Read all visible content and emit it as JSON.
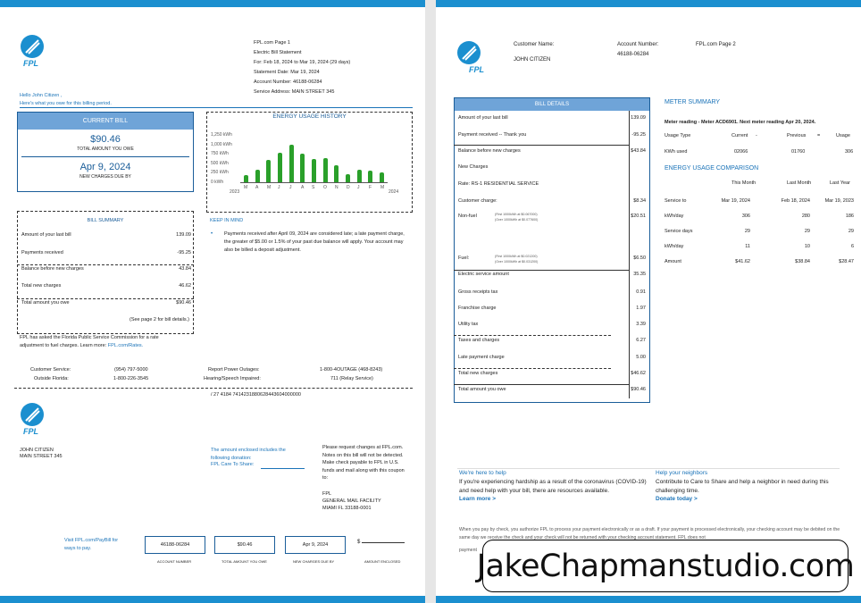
{
  "p1": {
    "header_lines": [
      "FPL.com   Page 1",
      "Electric Bill Statement",
      "For: Feb 18, 2024 to Mar 19, 2024 (29 days)",
      "Statement Date:  Mar 19, 2024",
      "Account Number: 46188-06284",
      "Service Address: MAIN STREET 345"
    ],
    "logo": "FPL",
    "greeting": "Hello John Citizen ,",
    "greeting2": "Here's what you owe for this billing period.",
    "current_bill": {
      "title": "CURRENT BILL",
      "amount": "$90.46",
      "amount_label": "TOTAL AMOUNT YOU OWE",
      "due_date": "Apr 9, 2024",
      "due_label": "NEW CHARGES DUE BY"
    },
    "energy": {
      "title": "ENERGY USAGE HISTORY",
      "yticks": [
        "1,250 kWh",
        "1,000 kWh",
        "750 kWh",
        "500 kWh",
        "250 kWh",
        "0 kWh"
      ],
      "months": [
        "M",
        "A",
        "M",
        "J",
        "J",
        "A",
        "S",
        "O",
        "N",
        "D",
        "J",
        "F",
        "M"
      ],
      "year_start": "2023",
      "year_end": "2024"
    },
    "chart_data": {
      "type": "bar",
      "title": "ENERGY USAGE HISTORY",
      "ylabel": "",
      "ylim": [
        0,
        1250
      ],
      "categories": [
        "M",
        "A",
        "M",
        "J",
        "J",
        "A",
        "S",
        "O",
        "N",
        "D",
        "J",
        "F",
        "M"
      ],
      "values": [
        190,
        320,
        600,
        770,
        1000,
        760,
        620,
        630,
        440,
        220,
        340,
        300,
        260
      ]
    },
    "bill_summary": {
      "title": "BILL SUMMARY",
      "rows": [
        [
          "Amount of your last bill",
          "139.09"
        ],
        [
          "Payments received",
          "-95.25"
        ],
        [
          "Balance before new charges",
          "43.84"
        ],
        [
          "Total new charges",
          "46.62"
        ],
        [
          "Total amount you owe",
          "$90.46"
        ]
      ],
      "note": "(See page 2 for bill details.)"
    },
    "keep_in_mind": {
      "title": "KEEP IN MIND",
      "bullet": "Payments received after April 09, 2024 are considered late; a late payment charge, the greater of $5.00 or 1.5% of your past due balance will apply. Your account may also be billed a deposit adjustment."
    },
    "psc_note": "FPL has asked the Florida Public Service Commission for a rate adjustment to fuel charges. Learn more:",
    "psc_link": "FPL.com/Rates.",
    "contacts": [
      [
        "Customer Service:",
        "(954) 797-5000",
        "Report Power Outages:",
        "1-800-4OUTAGE (468-8243)"
      ],
      [
        "Outside Florida:",
        "1-800-226-3545",
        "Hearing/Speech Impaired:",
        "711 (Relay Service)"
      ]
    ],
    "scanline": "/ 27 4184 7414231880628443604000000",
    "stub_name": "JOHN CITIZEN",
    "stub_addr": "MAIN STREET 345",
    "donation": "The amount enclosed includes the following donation:",
    "donation2": "FPL Care To Share:",
    "request_text": "Please request changes at FPL.com. Notes on this bill will not be detected. Make check payable to FPL in U.S. funds and mail along with this coupon to:",
    "mail_lines": [
      "FPL",
      "GENERAL MAIL FACILITY",
      "MIAMI FL 33188-0001"
    ],
    "visit": "Visit FPL.com/PayBill for ways to pay.",
    "stub_boxes": [
      {
        "value": "46188-06284",
        "label": "ACCOUNT NUMBER"
      },
      {
        "value": "$90.46",
        "label": "TOTAL AMOUNT YOU OWE"
      },
      {
        "value": "Apr 9, 2024",
        "label": "NEW CHARGES DUE BY"
      }
    ],
    "enclosed_label": "AMOUNT ENCLOSED",
    "enclosed_value": "$"
  },
  "p2": {
    "logo": "FPL",
    "cust_name_label": "Customer Name:",
    "cust_name": "JOHN CITIZEN",
    "acct_label": "Account Number:",
    "acct": "46188-06284",
    "page_label": "FPL.com Page 2",
    "bill_details": {
      "title": "BILL DETAILS",
      "rows": [
        [
          "Amount of your last bill",
          "139.09"
        ],
        [
          "Payment received -- Thank you",
          "-95.25"
        ],
        [
          "Balance before new charges",
          "$43.84"
        ],
        [
          "New Charges",
          ""
        ],
        [
          "Rate: RS-1 RESIDENTIAL SERVICE",
          ""
        ],
        [
          "Customer charge:",
          "$8.34"
        ],
        [
          "Non-fuel",
          "$20.51"
        ],
        [
          "Fuel:",
          "$6.50"
        ],
        [
          "Electric service amount",
          "35.35"
        ],
        [
          "Gross receipts tax",
          "0.91"
        ],
        [
          "Franchise charge",
          "1.97"
        ],
        [
          "Utility tax",
          "3.39"
        ],
        [
          "Taxes and charges",
          "6.27"
        ],
        [
          "Late payment charge",
          "5.00"
        ],
        [
          "Total new charges",
          "$46.62"
        ],
        [
          "Total amount you owe",
          "$90.46"
        ]
      ],
      "nonfuel_sub": [
        "(First 1000kWh at $0.067000)",
        "(Over 1000kWh at $0.077600)"
      ],
      "fuel_sub": [
        "(First 1000kWh at $0.021200)",
        "(Over 1000kWh at $0.031200)"
      ]
    },
    "meter": {
      "title": "METER SUMMARY",
      "reading": "Meter reading - Meter ACD6901. Next meter reading Apr 20, 2024.",
      "headers": [
        "Usage Type",
        "Current",
        "-",
        "Previous",
        "=",
        "Usage"
      ],
      "row": [
        "KWh used",
        "02066",
        "",
        "01760",
        "",
        "306"
      ]
    },
    "comparison": {
      "title": "ENERGY USAGE COMPARISON",
      "headers": [
        "",
        "This Month",
        "Last Month",
        "Last Year"
      ],
      "rows": [
        [
          "Service to",
          "Mar 19, 2024",
          "Feb 18, 2024",
          "Mar 19, 2023"
        ],
        [
          "kWh/day",
          "306",
          "280",
          "186"
        ],
        [
          "Service days",
          "29",
          "29",
          "29"
        ],
        [
          "kWh/day",
          "11",
          "10",
          "6"
        ],
        [
          "Amount",
          "$41.62",
          "$38.84",
          "$28.47"
        ]
      ]
    },
    "help": {
      "title": "We're here to help",
      "text": "If you're experiencing hardship as a result of the coronavirus (COVID-19) and need help with your bill, there are resources available.",
      "link": "Learn more >"
    },
    "neighbors": {
      "title": "Help your neighbors",
      "text": "Contribute to Care to Share and help a neighbor in need during this challenging time.",
      "link": "Donate today >"
    },
    "footer": "When you pay by check, you authorize FPL to process your payment electronically or as a draft. If your payment is processed electronically, your checking account may be debited on the same day we receive the check and your check will not be returned with your checking account statement. FPL does not",
    "footer2": "payment",
    "watermark": "JakeChapmanstudio.com"
  }
}
